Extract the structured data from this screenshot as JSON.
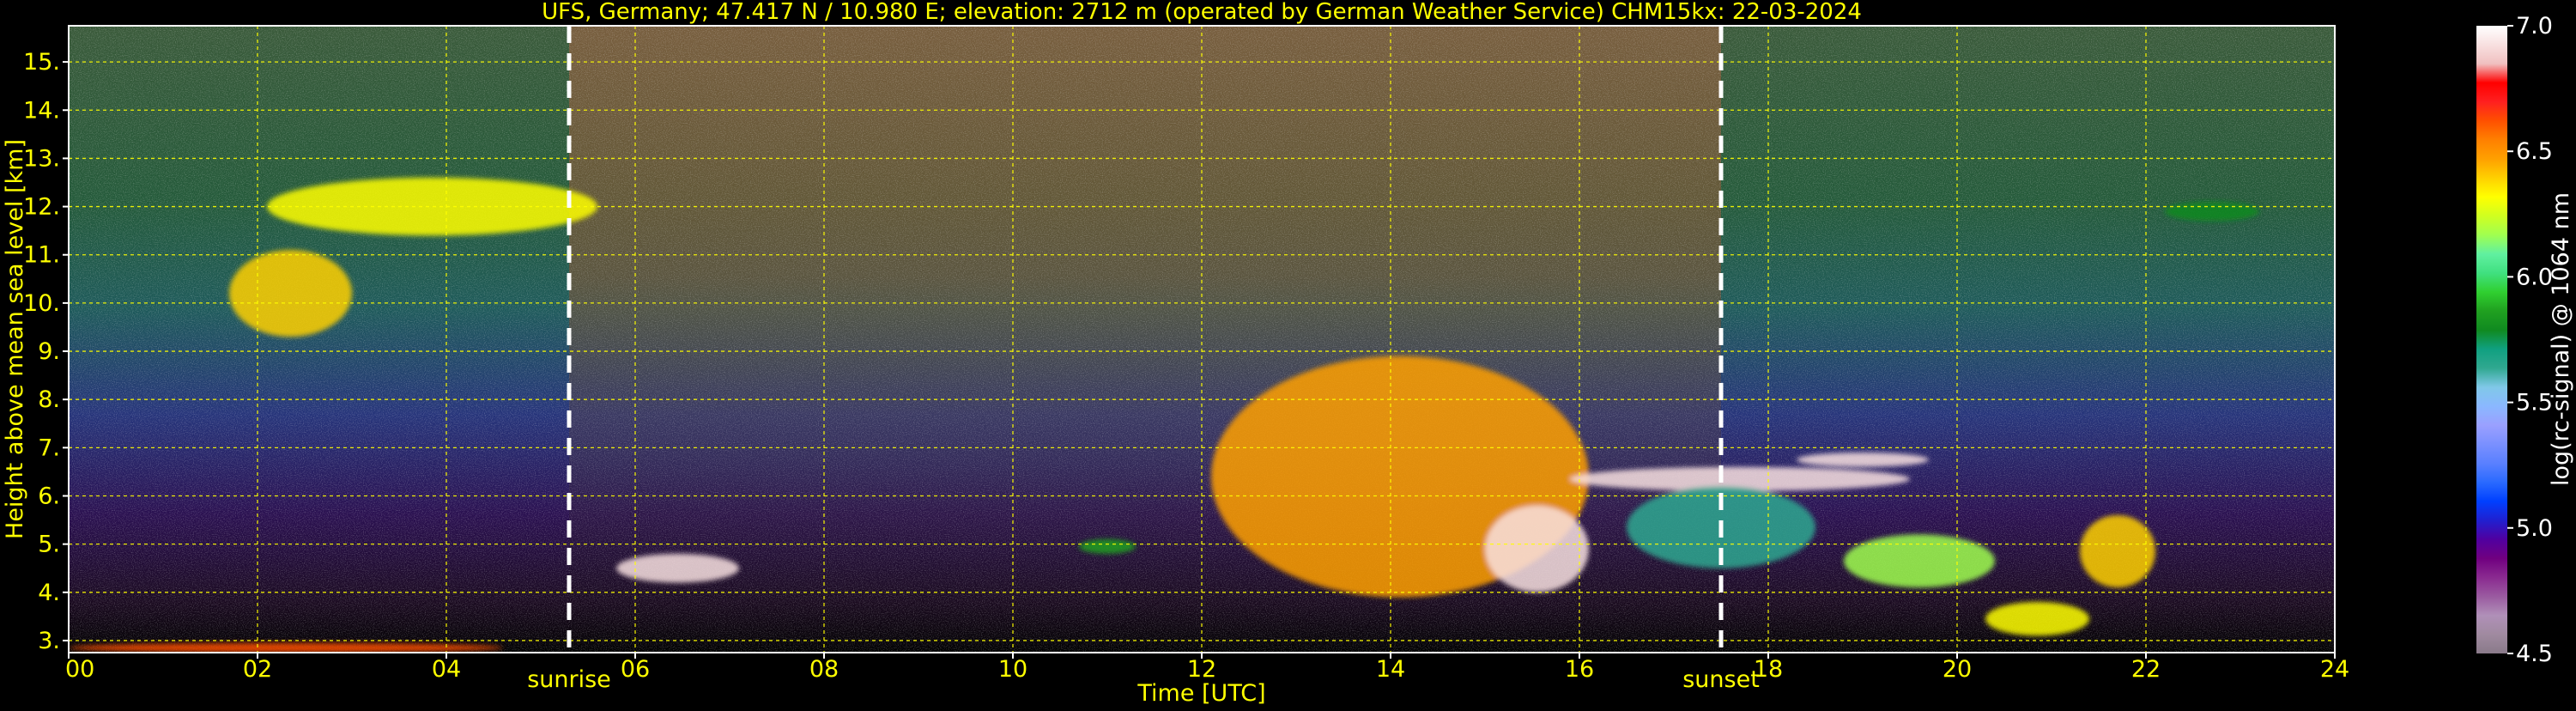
{
  "chart_data": {
    "type": "heatmap",
    "title": "UFS, Germany; 47.417 N / 10.980 E; elevation: 2712 m  (operated by German Weather Service)    CHM15kx: 22-03-2024",
    "xlabel": "Time [UTC]",
    "ylabel": "Height above mean sea level [km]",
    "xlim": [
      0,
      24
    ],
    "ylim": [
      2.75,
      15.75
    ],
    "x_ticks": [
      0,
      2,
      4,
      6,
      8,
      10,
      12,
      14,
      16,
      18,
      20,
      22,
      24
    ],
    "x_tick_labels": [
      "00",
      "02",
      "04",
      "06",
      "08",
      "10",
      "12",
      "14",
      "16",
      "18",
      "20",
      "22",
      "24"
    ],
    "y_ticks": [
      3,
      4,
      5,
      6,
      7,
      8,
      9,
      10,
      11,
      12,
      13,
      14,
      15
    ],
    "y_tick_labels": [
      "3.",
      "4.",
      "5.",
      "6.",
      "7.",
      "8.",
      "9.",
      "10.",
      "11.",
      "12.",
      "13.",
      "14.",
      "15."
    ],
    "grid": true,
    "colorbar": {
      "label": "log(rc-signal) @ 1064 nm",
      "range": [
        4.5,
        7.0
      ],
      "ticks": [
        4.5,
        5.0,
        5.5,
        6.0,
        6.5,
        7.0
      ],
      "tick_labels": [
        "4.5",
        "5.0",
        "5.5",
        "6.0",
        "6.5",
        "7.0"
      ],
      "colors": [
        "#8a7a8a",
        "#a08aa0",
        "#b090b8",
        "#9a5aa0",
        "#8a2a90",
        "#700080",
        "#5000a0",
        "#2020d0",
        "#0040ff",
        "#2a6aff",
        "#5a80ff",
        "#7a90ff",
        "#9aa0ff",
        "#8ab8ff",
        "#80c8e8",
        "#30a890",
        "#10a080",
        "#108a20",
        "#20a020",
        "#30d030",
        "#40e080",
        "#60f0a0",
        "#a0ff50",
        "#d0ff20",
        "#ffff00",
        "#ffd000",
        "#ffa000",
        "#ff8000",
        "#ff5000",
        "#ff2020",
        "#ff0000",
        "#f0c0c0",
        "#f8e0e0",
        "#ffffff"
      ]
    },
    "vertical_markers": [
      {
        "label": "sunrise",
        "x": 5.3
      },
      {
        "label": "sunset",
        "x": 17.5
      }
    ],
    "features": [
      {
        "t0": 1.7,
        "t1": 3.0,
        "h0": 9.3,
        "h1": 11.1,
        "level": 6.4
      },
      {
        "t0": 2.1,
        "t1": 5.6,
        "h0": 11.4,
        "h1": 12.6,
        "level": 6.3
      },
      {
        "t0": 0.0,
        "t1": 4.6,
        "h0": 2.75,
        "h1": 2.95,
        "level": 6.6
      },
      {
        "t0": 5.8,
        "t1": 7.1,
        "h0": 4.2,
        "h1": 4.8,
        "level": 6.9
      },
      {
        "t0": 10.7,
        "t1": 11.3,
        "h0": 4.8,
        "h1": 5.1,
        "level": 5.9
      },
      {
        "t0": 12.1,
        "t1": 16.1,
        "h0": 3.9,
        "h1": 8.9,
        "level": 6.5
      },
      {
        "t0": 15.0,
        "t1": 16.1,
        "h0": 4.0,
        "h1": 5.8,
        "level": 6.9
      },
      {
        "t0": 15.9,
        "t1": 19.5,
        "h0": 6.1,
        "h1": 6.6,
        "level": 6.9
      },
      {
        "t0": 18.3,
        "t1": 19.7,
        "h0": 6.6,
        "h1": 6.9,
        "level": 6.9
      },
      {
        "t0": 16.5,
        "t1": 18.5,
        "h0": 4.5,
        "h1": 6.2,
        "level": 5.6
      },
      {
        "t0": 18.8,
        "t1": 20.4,
        "h0": 4.1,
        "h1": 5.2,
        "level": 6.2
      },
      {
        "t0": 20.3,
        "t1": 21.4,
        "h0": 3.1,
        "h1": 3.8,
        "level": 6.3
      },
      {
        "t0": 21.3,
        "t1": 22.1,
        "h0": 4.1,
        "h1": 5.6,
        "level": 6.4
      },
      {
        "t0": 22.2,
        "t1": 23.2,
        "h0": 11.7,
        "h1": 12.1,
        "level": 5.8
      }
    ]
  }
}
